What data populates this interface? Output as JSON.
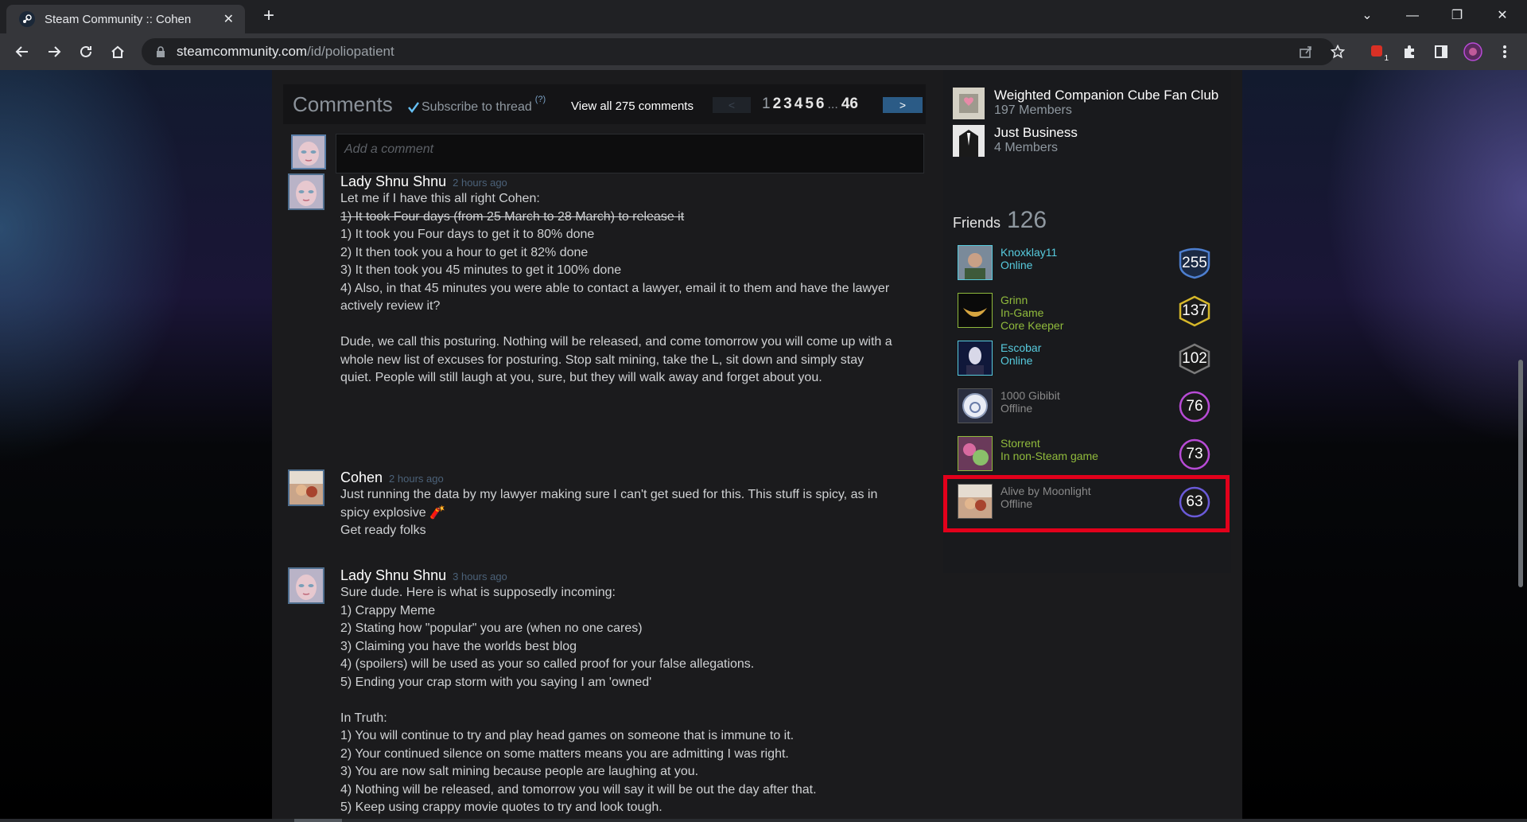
{
  "browser": {
    "tab_title": "Steam Community :: Cohen",
    "url_host": "steamcommunity.com",
    "url_path": "/id/poliopatient",
    "extension_badge": "1"
  },
  "comments": {
    "title": "Comments",
    "subscribe_label": "Subscribe to thread",
    "help_marker": "(?)",
    "view_all": "View all 275 comments",
    "prev": "<",
    "next": ">",
    "pages": [
      "1",
      "2",
      "3",
      "4",
      "5",
      "6"
    ],
    "ellipsis": "...",
    "last_page": "46",
    "placeholder": "Add a comment",
    "items": [
      {
        "author": "Lady Shnu Shnu",
        "time": "2 hours ago",
        "lines": [
          "Let me if I have this all right Cohen:",
          "1) It took Four days (from 25 March to 28 March) to release it",
          "1) It took you Four days to get it to 80% done",
          "2) It then took you a hour to get it 82% done",
          "3) It then took you 45 minutes to get it 100% done",
          "4) Also, in that 45 minutes you were able to contact a lawyer, email it to them and have the lawyer actively review it?",
          "",
          "Dude, we call this posturing. Nothing will be released, and come tomorrow you will come up with a whole new list of excuses for posturing. Stop salt mining, take the L, sit down and simply stay quiet. People will still laugh at you, sure, but they will walk away and forget about you."
        ]
      },
      {
        "author": "Cohen",
        "time": "2 hours ago",
        "lines": [
          "Just running the data by my lawyer making sure I can't get sued for this. This stuff is spicy, as in spicy explosive 🧨",
          "Get ready folks"
        ]
      },
      {
        "author": "Lady Shnu Shnu",
        "time": "3 hours ago",
        "lines": [
          "Sure dude. Here is what is supposedly incoming:",
          "1) Crappy Meme",
          "2) Stating how \"popular\" you are (when no one cares)",
          "3) Claiming you have the worlds best blog",
          "4) (spoilers) will be used as your so called proof for your false allegations.",
          "5) Ending your crap storm with you saying I am 'owned'",
          "",
          "In Truth:",
          "1) You will continue to try and play head games on someone that is immune to it.",
          "2) Your continued silence on some matters means you are admitting I was right.",
          "3) You are now salt mining because people are laughing at you.",
          "4) Nothing will be released, and tomorrow you will say it will be out the day after that.",
          "5) Keep using crappy movie quotes to try and look tough."
        ]
      }
    ]
  },
  "groups": [
    {
      "name": "Weighted Companion Cube Fan Club",
      "members": "197 Members"
    },
    {
      "name": "Just Business",
      "members": "4 Members"
    }
  ],
  "friends": {
    "label": "Friends",
    "count": "126",
    "list": [
      {
        "name": "Knoxklay11",
        "status": "Online",
        "game": "",
        "level": "255",
        "state": "online",
        "badge_color": "#4d7fd0",
        "badge_shape": "shield"
      },
      {
        "name": "Grinn",
        "status": "In-Game",
        "game": "Core Keeper",
        "level": "137",
        "state": "ingame",
        "badge_color": "#d6b82a",
        "badge_shape": "hexagon"
      },
      {
        "name": "Escobar",
        "status": "Online",
        "game": "",
        "level": "102",
        "state": "online",
        "badge_color": "#7a7a7a",
        "badge_shape": "hexagon"
      },
      {
        "name": "1000 Gibibit",
        "status": "Offline",
        "game": "",
        "level": "76",
        "state": "offline",
        "badge_color": "#b84bd6",
        "badge_shape": "circle"
      },
      {
        "name": "Storrent",
        "status": "In non-Steam game",
        "game": "",
        "level": "73",
        "state": "ingame",
        "badge_color": "#b84bd6",
        "badge_shape": "circle"
      },
      {
        "name": "Alive by Moonlight",
        "status": "Offline",
        "game": "",
        "level": "63",
        "state": "offline",
        "badge_color": "#6a5ad8",
        "badge_shape": "circle"
      }
    ]
  }
}
